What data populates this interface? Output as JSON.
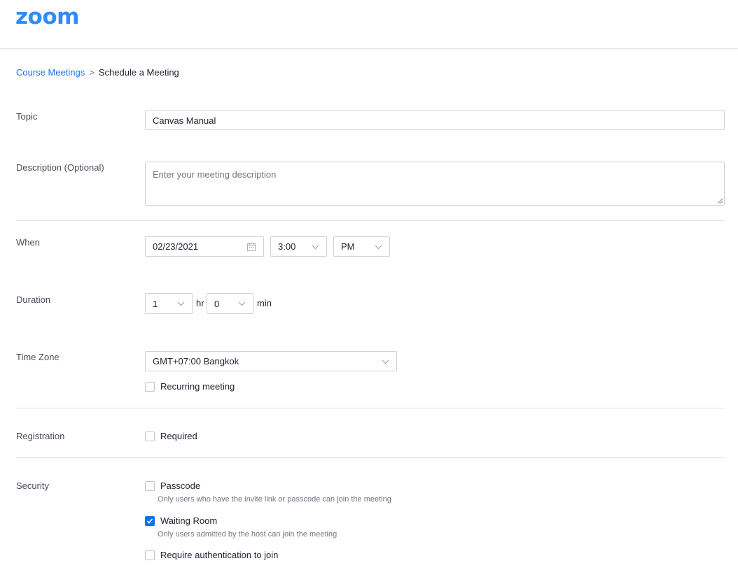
{
  "app": {
    "logo_text": "zoom",
    "brand_color": "#2d8cff",
    "accent_color": "#0e72ed"
  },
  "breadcrumb": {
    "parent": "Course Meetings",
    "separator": ">",
    "current": "Schedule a Meeting"
  },
  "form": {
    "topic": {
      "label": "Topic",
      "value": "Canvas Manual"
    },
    "description": {
      "label": "Description (Optional)",
      "placeholder": "Enter your meeting description"
    },
    "when": {
      "label": "When",
      "date": "02/23/2021",
      "date_icon": "calendar-icon",
      "time": "3:00",
      "ampm": "PM"
    },
    "duration": {
      "label": "Duration",
      "hours": "1",
      "hours_unit": "hr",
      "minutes": "0",
      "minutes_unit": "min"
    },
    "timezone": {
      "label": "Time Zone",
      "value": "GMT+07:00 Bangkok",
      "recurring_label": "Recurring meeting",
      "recurring_checked": false
    },
    "registration": {
      "label": "Registration",
      "required_label": "Required",
      "required_checked": false
    },
    "security": {
      "label": "Security",
      "passcode_label": "Passcode",
      "passcode_checked": false,
      "passcode_hint": "Only users who have the invite link or passcode can join the meeting",
      "waiting_room_label": "Waiting Room",
      "waiting_room_checked": true,
      "waiting_room_hint": "Only users admitted by the host can join the meeting",
      "auth_label": "Require authentication to join",
      "auth_checked": false
    }
  }
}
